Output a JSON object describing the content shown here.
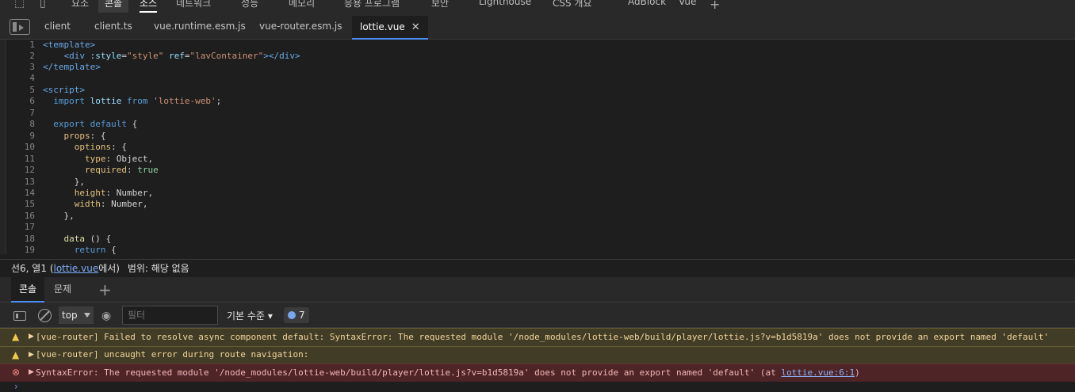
{
  "devtools_tabs": [
    "요소",
    "콘솔",
    "소스",
    "네트워크",
    "성능",
    "메모리",
    "응용 프로그램",
    "보안",
    "Lighthouse",
    "CSS 개요",
    "AdBlock",
    "Vue"
  ],
  "file_tabs": [
    {
      "label": "client"
    },
    {
      "label": "client.ts"
    },
    {
      "label": "vue.runtime.esm.js"
    },
    {
      "label": "vue-router.esm.js"
    },
    {
      "label": "lottie.vue",
      "active": true
    }
  ],
  "editor": {
    "line_numbers": [
      "1",
      "2",
      "3",
      "4",
      "5",
      "6",
      "7",
      "8",
      "9",
      "10",
      "11",
      "12",
      "13",
      "14",
      "15",
      "16",
      "17",
      "18",
      "19"
    ]
  },
  "status": {
    "position": "선6, 열1",
    "file_link": "lottie.vue",
    "suffix": "에서)",
    "scope": "범위: 해당 없음"
  },
  "drawer": {
    "tabs": [
      "콘솔",
      "문제"
    ]
  },
  "console_toolbar": {
    "context": "top",
    "filter_placeholder": "필터",
    "level": "기본 수준",
    "message_count": "7"
  },
  "messages": [
    {
      "level": "warning",
      "text": "[vue-router] Failed to resolve async component default: SyntaxError: The requested module '/node_modules/lottie-web/build/player/lottie.js?v=b1d5819a' does not provide an export named 'default'"
    },
    {
      "level": "warning",
      "text": "[vue-router] uncaught error during route navigation:"
    },
    {
      "level": "error",
      "text": "SyntaxError: The requested module '/node_modules/lottie-web/build/player/lottie.js?v=b1d5819a' does not provide an export named 'default' (at ",
      "link": "lottie.vue:6:1",
      "tail": ")"
    }
  ],
  "colors": {
    "accent": "#4c8df6",
    "warning_bg": "#413c26",
    "error_bg": "#4e2427"
  }
}
